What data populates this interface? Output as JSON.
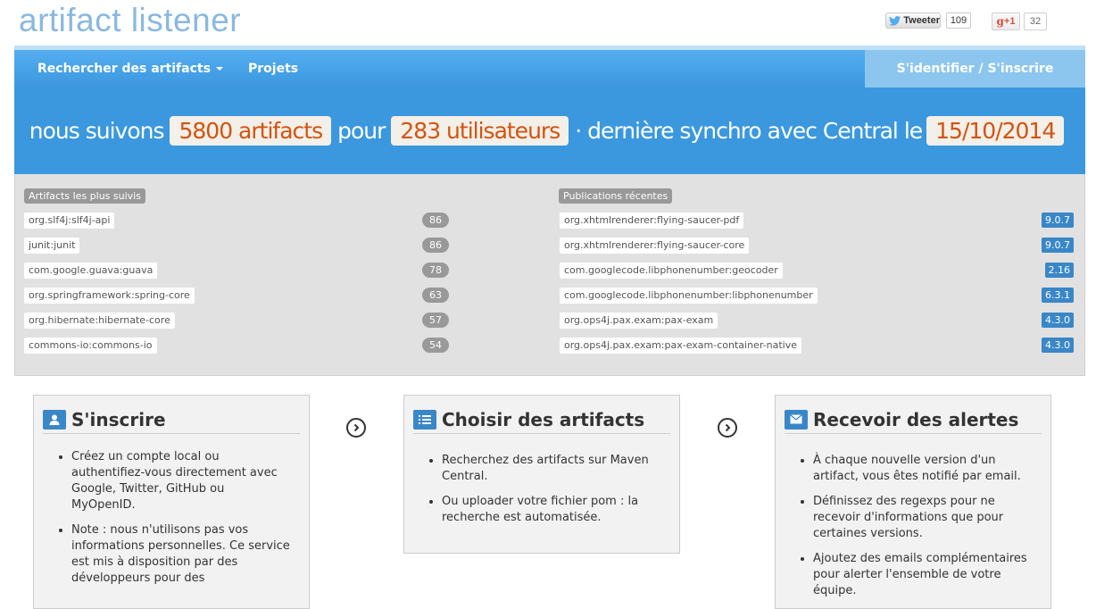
{
  "site": {
    "logo": "artifact listener"
  },
  "social": {
    "tweet_label": "Tweeter",
    "tweet_count": "109",
    "gplus_label": "+1",
    "gplus_count": "32"
  },
  "nav": {
    "search_label": "Rechercher des artifacts",
    "projects_label": "Projets",
    "login_label": "S'identifier / S'inscrire"
  },
  "hero": {
    "t1": "nous suivons",
    "artifacts": "5800 artifacts",
    "t2": "pour",
    "users": "283 utilisateurs",
    "t3": "· dernière synchro avec Central le",
    "date": "15/10/2014"
  },
  "most_followed": {
    "title": "Artifacts les plus suivis",
    "items": [
      {
        "name": "org.slf4j:slf4j-api",
        "count": "86"
      },
      {
        "name": "junit:junit",
        "count": "86"
      },
      {
        "name": "com.google.guava:guava",
        "count": "78"
      },
      {
        "name": "org.springframework:spring-core",
        "count": "63"
      },
      {
        "name": "org.hibernate:hibernate-core",
        "count": "57"
      },
      {
        "name": "commons-io:commons-io",
        "count": "54"
      }
    ]
  },
  "recent": {
    "title": "Publications récentes",
    "items": [
      {
        "name": "org.xhtmlrenderer:flying-saucer-pdf",
        "version": "9.0.7"
      },
      {
        "name": "org.xhtmlrenderer:flying-saucer-core",
        "version": "9.0.7"
      },
      {
        "name": "com.googlecode.libphonenumber:geocoder",
        "version": "2.16"
      },
      {
        "name": "com.googlecode.libphonenumber:libphonenumber",
        "version": "6.3.1"
      },
      {
        "name": "org.ops4j.pax.exam:pax-exam",
        "version": "4.3.0"
      },
      {
        "name": "org.ops4j.pax.exam:pax-exam-container-native",
        "version": "4.3.0"
      }
    ]
  },
  "cards": [
    {
      "title": "S'inscrire",
      "icon": "user-icon",
      "bullets": [
        "Créez un compte local ou authentifiez-vous directement avec Google, Twitter, GitHub ou MyOpenID.",
        "Note : nous n'utilisons pas vos informations personnelles. Ce service est mis à disposition par des développeurs pour des"
      ]
    },
    {
      "title": "Choisir des artifacts",
      "icon": "list-icon",
      "bullets": [
        "Recherchez des artifacts sur Maven Central.",
        "Ou uploader votre fichier pom : la recherche est automatisée."
      ]
    },
    {
      "title": "Recevoir des alertes",
      "icon": "envelope-icon",
      "bullets": [
        "À chaque nouvelle version d'un artifact, vous êtes notifié par email.",
        "Définissez des regexps pour ne recevoir d'informations que pour certaines versions.",
        "Ajoutez des emails complémentaires pour alerter l'ensemble de votre équipe."
      ]
    }
  ]
}
